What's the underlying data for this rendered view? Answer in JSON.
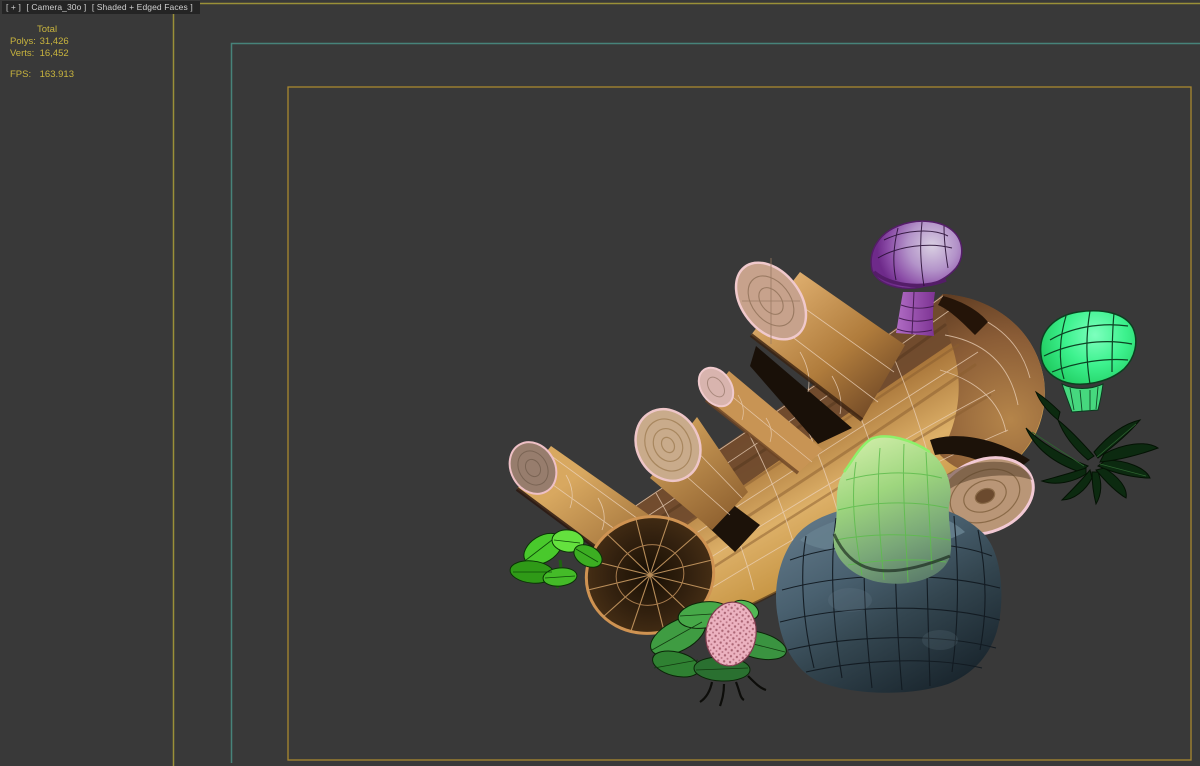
{
  "viewport": {
    "background_color": "#393939",
    "label": {
      "menu": "[ + ]",
      "camera": "[ Camera_30o ]",
      "shading": "[ Shaded + Edged Faces ]"
    },
    "stats": {
      "total_header": "Total",
      "rows": [
        {
          "label": "Polys:",
          "value": "31,426"
        },
        {
          "label": "Verts:",
          "value": "16,452"
        }
      ],
      "fps": {
        "label": "FPS:",
        "value": "163.913"
      },
      "text_color": "#c8b43e"
    },
    "safe_frames": {
      "live_area_color": "#9a9038",
      "action_safe_color": "#47837a",
      "title_safe_color": "#a8872f"
    }
  },
  "scene": {
    "description": "Stylized low-poly forest log with mushrooms, rocks and plants rendered as Shaded + Edged Faces",
    "objects": [
      "tree-log",
      "branch-stump-top",
      "branch-stump-middle",
      "branch-stump-small",
      "branch-stump-lower-left",
      "branch-stump-right",
      "purple-mushroom",
      "green-mushroom",
      "dark-fern",
      "moss-rock",
      "stone-rock",
      "sprout-plant",
      "flower-plant"
    ],
    "palette": {
      "wood_light": "#ddb068",
      "wood_mid": "#b5813f",
      "wood_dark": "#6b4027",
      "bark_top": "#6f4a2d",
      "cut_face_ring": "#c89a62",
      "wire_pink": "#ecd2ba",
      "purple_cap": "#9a55b5",
      "purple_stem": "#a050bc",
      "green_cap": "#3df28e",
      "fern_green": "#0c2a10",
      "moss_green": "#9ed67e",
      "rock_blue": "#49606f",
      "leaf_green": "#3f9c42",
      "bud_pink": "#ecb2c0",
      "sprout_green": "#49c92c"
    }
  }
}
